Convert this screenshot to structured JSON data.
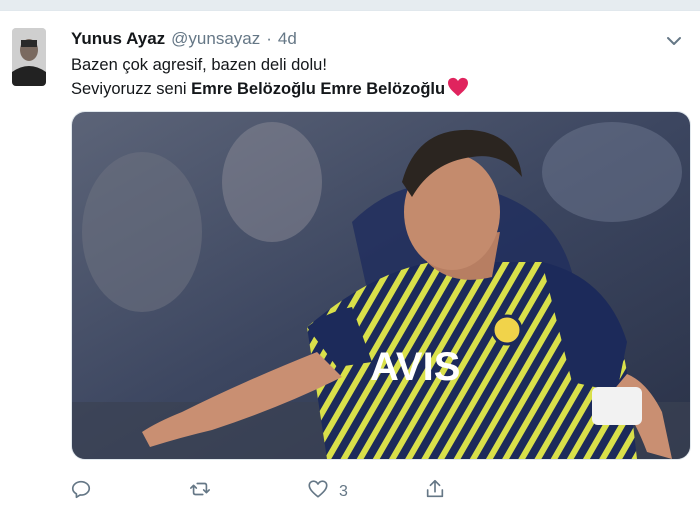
{
  "tweet": {
    "author_name": "Yunus Ayaz",
    "author_handle": "@yunsayaz",
    "separator": "·",
    "timestamp": "4d",
    "line1": "Bazen çok agresif, bazen deli dolu!",
    "line2_prefix": "Seviyoruzz seni ",
    "line2_bold": "Emre Belözoğlu Emre Belözoğlu",
    "emoji_icon": "red-heart-icon",
    "media": {
      "description_icon": "football-player-photo",
      "shirt_sponsor": "AVIS"
    }
  },
  "actions": {
    "reply_icon": "reply-icon",
    "retweet_icon": "retweet-icon",
    "like_icon": "like-icon",
    "like_count": "3",
    "share_icon": "share-icon"
  },
  "colors": {
    "text": "#14171a",
    "secondary": "#657786",
    "heart": "#e0245e",
    "jersey_navy": "#1c2a5a",
    "jersey_yellow": "#d9e04a"
  }
}
